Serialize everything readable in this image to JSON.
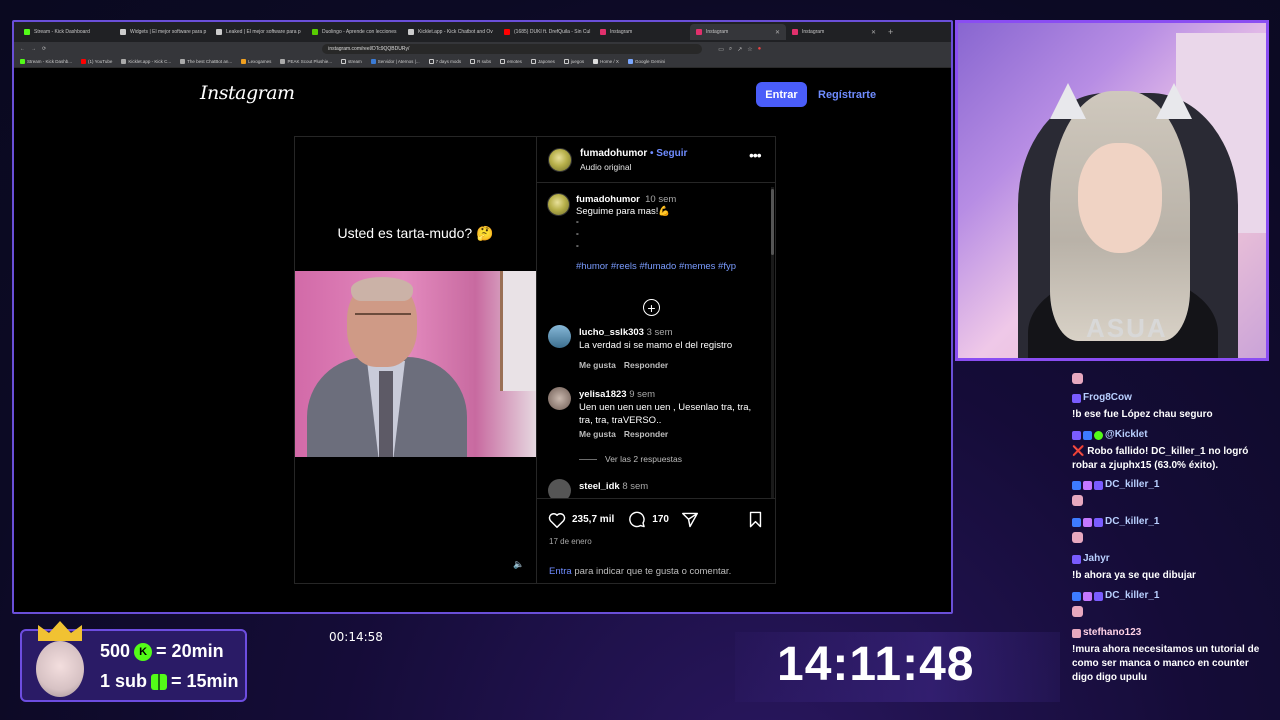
{
  "browser": {
    "tabs": [
      {
        "label": "Stream - Kick Dashboard",
        "color": "#53fc18"
      },
      {
        "label": "Widgets | El mejor software para p",
        "color": "#cccccc"
      },
      {
        "label": "Leaked | El mejor software para p",
        "color": "#cccccc"
      },
      {
        "label": "Duolingo - Aprende con lecciones",
        "color": "#58cc02"
      },
      {
        "label": "Kicklet.app - Kick Chatbot and Ov",
        "color": "#cccccc"
      },
      {
        "label": "(1685) DUKI ft. DrefQuila - Sin Cul",
        "color": "#ff0000"
      },
      {
        "label": "Instagram",
        "color": "#e1306c"
      },
      {
        "label": "Instagram",
        "color": "#e1306c"
      },
      {
        "label": "Instagram",
        "color": "#e1306c"
      }
    ],
    "url": "instagram.com/reel/DTc9QQBDURy/",
    "bookmarks": [
      "Stream - Kick Dashb...",
      "(1) YouTube",
      "Kicklet.app - Kick C...",
      "The best ChatBot an...",
      "Lexogames",
      "PEAK Scout Plushie...",
      "stream",
      "Servidor | Aternos |...",
      "7 days mods",
      "R subs",
      "emotes",
      "Japones",
      "juegos",
      "Home / X",
      "Google Gemini"
    ]
  },
  "instagram": {
    "logo": "Instagram",
    "login_button": "Entrar",
    "signup_link": "Regístrarte",
    "video_caption": "Usted es tarta-mudo? 🤔",
    "author": "fumadohumor",
    "follow": "• Seguir",
    "audio": "Audio original",
    "caption": {
      "user": "fumadohumor",
      "time": "10 sem",
      "text": "Seguime para mas!💪",
      "dots": "°\n°\n°",
      "hashtags": "#humor #reels #fumado #memes #fyp"
    },
    "comments": [
      {
        "user": "lucho_sslk303",
        "time": "3 sem",
        "text": "La verdad si se mamo el del registro",
        "like": "Me gusta",
        "reply": "Responder"
      },
      {
        "user": "yelisa1823",
        "time": "9 sem",
        "text": "Uen uen uen uen uen , Uesenlao tra, tra, tra, tra, traVERSO..",
        "like": "Me gusta",
        "reply": "Responder",
        "view_replies": "Ver las 2 respuestas"
      },
      {
        "user": "steel_idk",
        "time": "8 sem"
      }
    ],
    "likes": "235,7 mil",
    "comment_count": "170",
    "date": "17 de enero",
    "login_prompt_link": "Entra",
    "login_prompt_text": " para indicar que te gusta o comentar."
  },
  "chat": [
    {
      "user": "Frog8Cow",
      "text": "!b ese fue López chau seguro"
    },
    {
      "user": "@Kicklet",
      "text": "❌ Robo fallido! DC_killer_1 no logró robar a zjuphx15 (63.0% éxito)."
    },
    {
      "user": "DC_killer_1",
      "text": ""
    },
    {
      "user": "DC_killer_1",
      "text": ""
    },
    {
      "user": "Jahyr",
      "text": "!b ahora ya se que dibujar"
    },
    {
      "user": "DC_killer_1",
      "text": ""
    },
    {
      "user": "stefhano123",
      "text": "!mura ahora necesitamos un tutorial de como ser manca o manco en counter digo digo upulu"
    }
  ],
  "overlay": {
    "promo_line1_amount": "500",
    "promo_line1_coin": "K",
    "promo_line1_rest": "= 20min",
    "promo_line2_amount": "1 sub",
    "promo_line2_rest": "= 15min",
    "timer": "00:14:58",
    "clock": "14:11:48"
  },
  "colors": {
    "accent": "#6d4de0",
    "instagram_blue": "#4a5df9",
    "kick_green": "#53fc18"
  }
}
